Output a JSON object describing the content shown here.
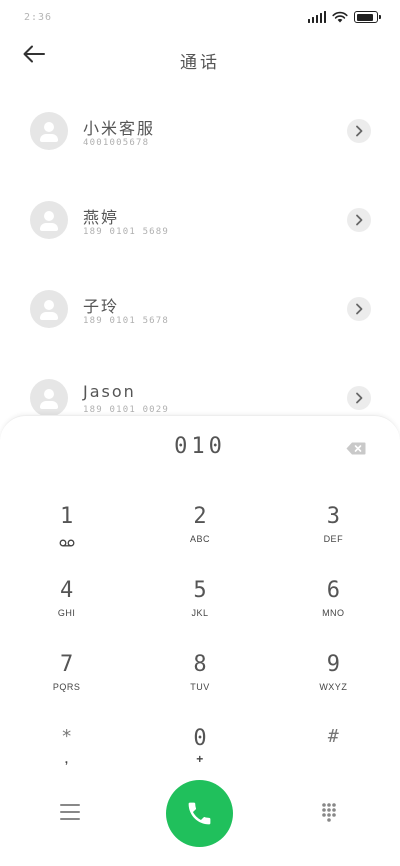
{
  "status_bar": {
    "time": "2:36",
    "battery_level": 0.85,
    "signal_bars": 4
  },
  "header": {
    "title": "通话"
  },
  "contacts": [
    {
      "name": "小米客服",
      "number": "4001005678"
    },
    {
      "name": "燕婷",
      "number": "189 0101 5689"
    },
    {
      "name": "子玲",
      "number": "189 0101 5678"
    },
    {
      "name": "Jason",
      "number": "189 0101 0029"
    }
  ],
  "dialpad": {
    "input": "010",
    "keys": [
      {
        "digit": "1",
        "letters": ""
      },
      {
        "digit": "2",
        "letters": "ABC"
      },
      {
        "digit": "3",
        "letters": "DEF"
      },
      {
        "digit": "4",
        "letters": "GHI"
      },
      {
        "digit": "5",
        "letters": "JKL"
      },
      {
        "digit": "6",
        "letters": "MNO"
      },
      {
        "digit": "7",
        "letters": "PQRS"
      },
      {
        "digit": "8",
        "letters": "TUV"
      },
      {
        "digit": "9",
        "letters": "WXYZ"
      },
      {
        "digit": "*",
        "letters": ","
      },
      {
        "digit": "0",
        "letters": "+"
      },
      {
        "digit": "#",
        "letters": ""
      }
    ]
  },
  "colors": {
    "call_button": "#20c05c",
    "avatar_bg": "#e6e6e6"
  },
  "icons": {
    "back": "arrow-left-icon",
    "detail": "chevron-right-icon",
    "voicemail": "voicemail-icon",
    "backspace": "backspace-icon",
    "menu": "menu-icon",
    "call": "phone-icon",
    "keypad": "keypad-icon"
  }
}
